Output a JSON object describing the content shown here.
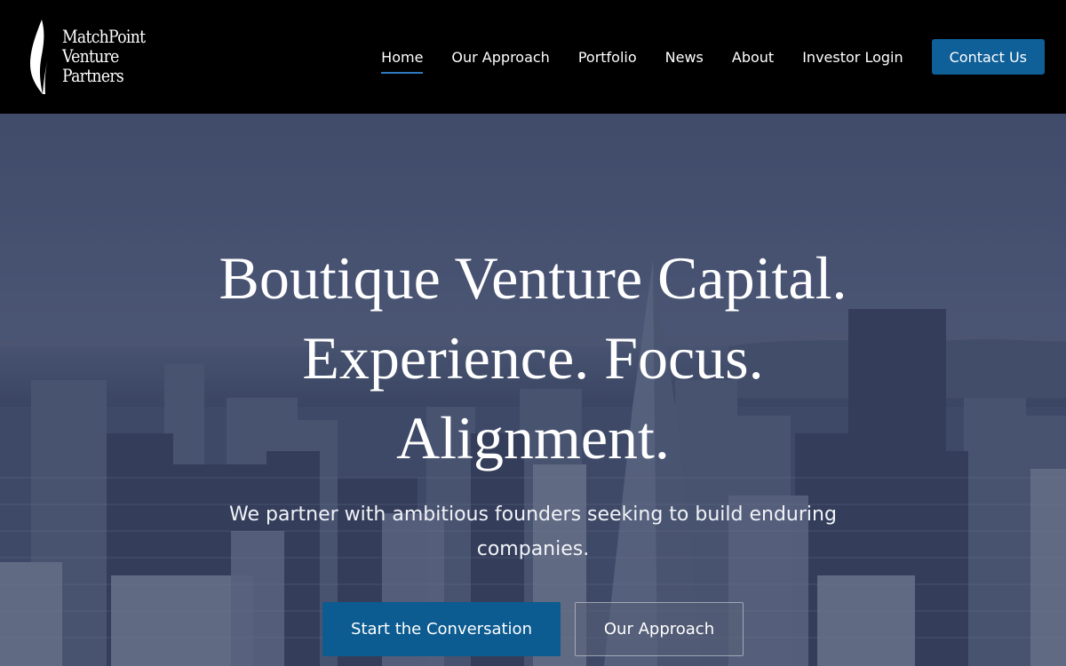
{
  "brand": {
    "line1": "MatchPoint",
    "line2": "Venture",
    "line3": "Partners"
  },
  "nav": {
    "items": [
      {
        "label": "Home",
        "active": true
      },
      {
        "label": "Our Approach"
      },
      {
        "label": "Portfolio"
      },
      {
        "label": "News"
      },
      {
        "label": "About"
      },
      {
        "label": "Investor Login"
      }
    ],
    "cta": "Contact Us"
  },
  "hero": {
    "title_line1": "Boutique Venture Capital.",
    "title_line2": "Experience. Focus.",
    "title_line3": "Alignment.",
    "subtitle": "We partner with ambitious founders seeking to build enduring companies.",
    "primary_button": "Start the Conversation",
    "secondary_button": "Our Approach"
  },
  "colors": {
    "accent": "#0f5f98",
    "header_bg": "#000000",
    "active_underline": "#2c79c0"
  },
  "icons": {
    "logo": "flame-leaf-icon"
  }
}
